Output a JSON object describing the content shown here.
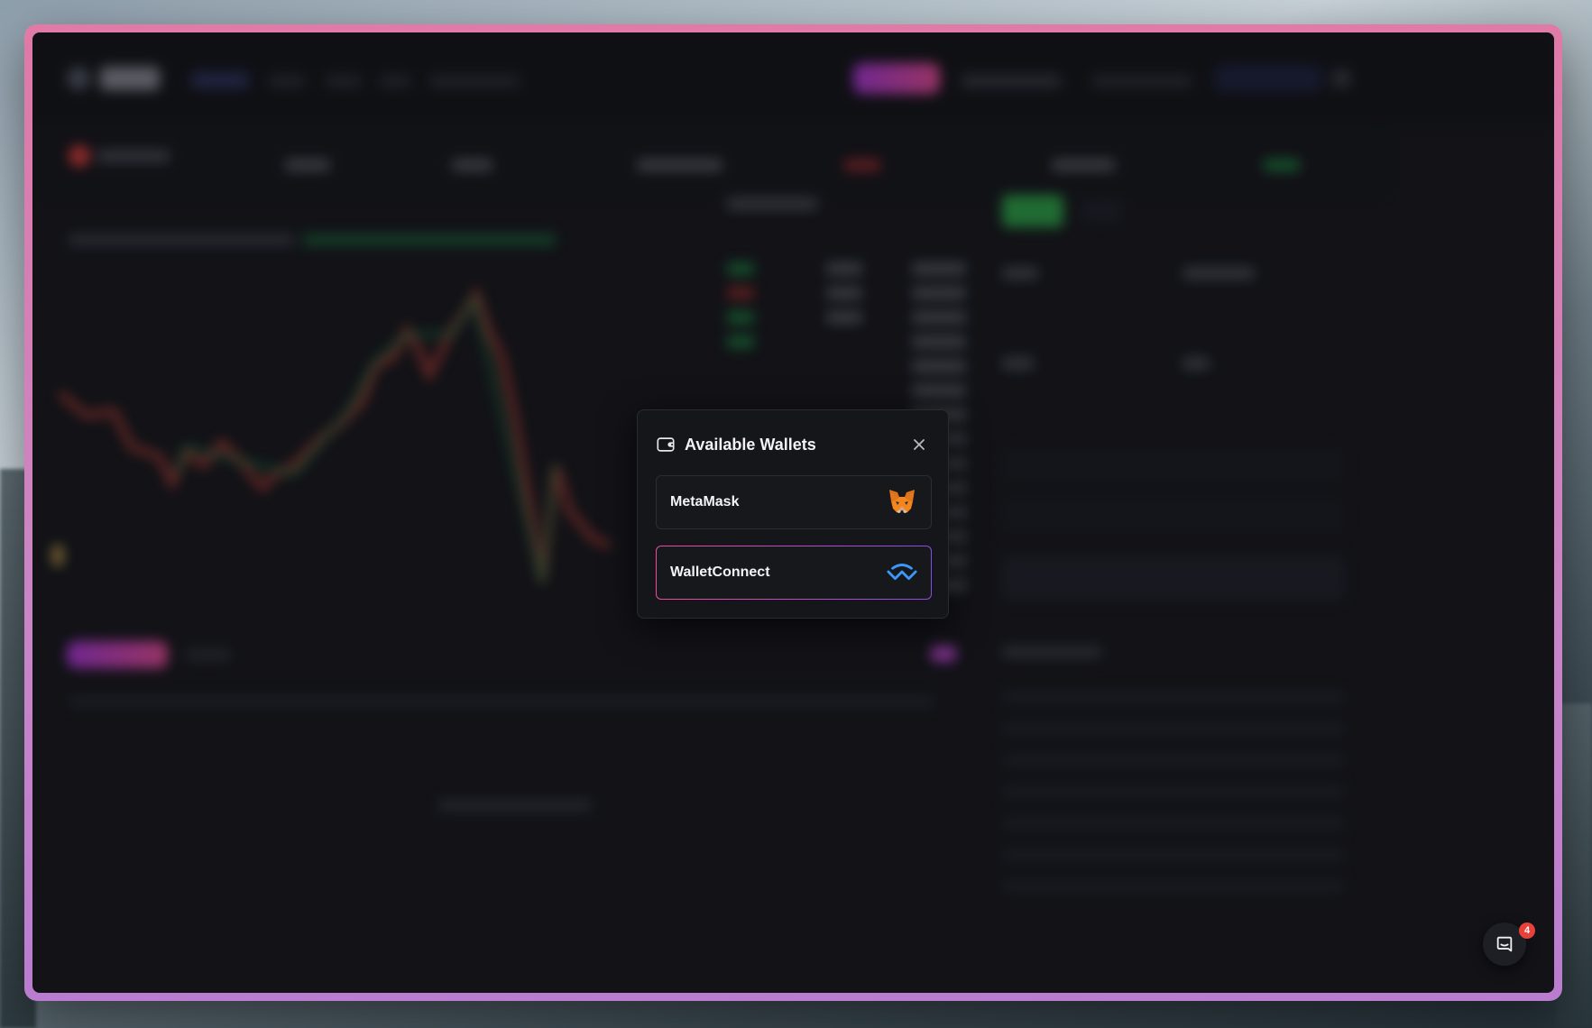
{
  "modal": {
    "title": "Available Wallets",
    "close_icon": "close-icon",
    "title_icon": "wallet-icon",
    "wallets": [
      {
        "label": "MetaMask",
        "icon": "metamask-fox-icon"
      },
      {
        "label": "WalletConnect",
        "icon": "walletconnect-icon",
        "selected": true
      }
    ]
  },
  "chat": {
    "icon": "chat-bubble-icon",
    "badge_count": "4"
  },
  "colors": {
    "frame_top": "#e07aa6",
    "frame_bottom": "#b97ccf",
    "app_bg": "#17181c",
    "modal_bg": "#151619",
    "accent_gradient_start": "#f04aa0",
    "accent_gradient_end": "#8a4ce8",
    "walletconnect_blue": "#3b99fc",
    "badge_red": "#e8413a"
  }
}
